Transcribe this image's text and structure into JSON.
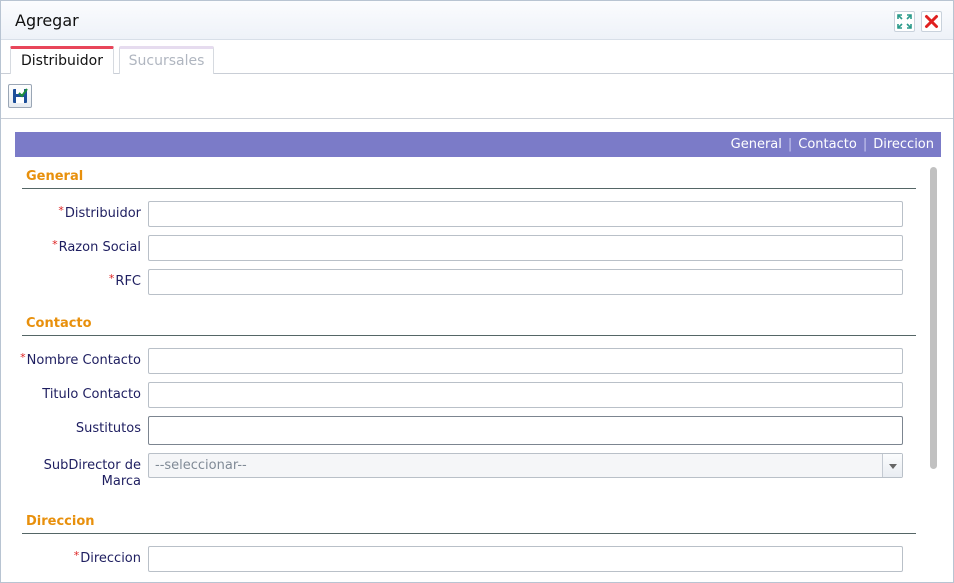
{
  "window": {
    "title": "Agregar"
  },
  "tabs": [
    {
      "label": "Distribuidor",
      "active": true
    },
    {
      "label": "Sucursales",
      "active": false
    }
  ],
  "toolbar": {
    "save_icon": "save-disk-icon"
  },
  "nav": {
    "links": [
      "General",
      "Contacto",
      "Direccion"
    ],
    "separator": "|"
  },
  "sections": {
    "general": {
      "title": "General",
      "distribuidor_label": "Distribuidor",
      "razon_social_label": "Razon Social",
      "rfc_label": "RFC"
    },
    "contacto": {
      "title": "Contacto",
      "nombre_contacto_label": "Nombre Contacto",
      "titulo_contacto_label": "Titulo Contacto",
      "sustitutos_label": "Sustitutos",
      "subdirector_label": "SubDirector de Marca",
      "subdirector_value": "--seleccionar--"
    },
    "direccion": {
      "title": "Direccion",
      "direccion_label": "Direccion"
    }
  },
  "required_marker": "*",
  "colors": {
    "navbar": "#7b7bc8",
    "section_title": "#e8900c",
    "active_tab": "#e8465a",
    "required": "#dd2222"
  }
}
